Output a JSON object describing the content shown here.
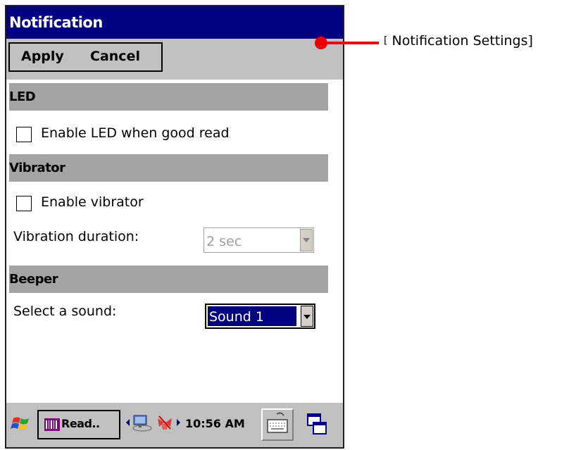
{
  "window": {
    "title": "Notification"
  },
  "menu": {
    "apply_label": "Apply",
    "cancel_label": "Cancel"
  },
  "sections": {
    "led": {
      "title": "LED",
      "enable_label": "Enable LED when good read",
      "enable_checked": false
    },
    "vibrator": {
      "title": "Vibrator",
      "enable_label": "Enable vibrator",
      "enable_checked": false,
      "duration_label": "Vibration duration:",
      "duration_value": "2 sec",
      "duration_disabled": true
    },
    "beeper": {
      "title": "Beeper",
      "sound_label": "Select a sound:",
      "sound_value": "Sound 1"
    }
  },
  "taskbar": {
    "task_label": "Read..",
    "clock": "10:56 AM",
    "icons": [
      "windows-start-icon",
      "scanner-app-icon",
      "network-icon",
      "unplugged-icon",
      "keyboard-icon",
      "desktop-switch-icon"
    ]
  },
  "annotation": {
    "bracket_open": "[",
    "text": "Notification Settings]"
  },
  "colors": {
    "title_bar": "#000080",
    "menu_bar": "#c0c0c0",
    "section_header": "#a4a4a4",
    "annotation": "#ee0000",
    "selection": "#000080"
  }
}
